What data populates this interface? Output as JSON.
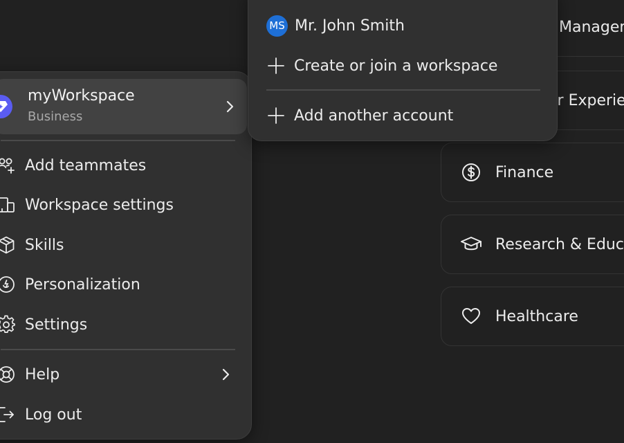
{
  "background_cards": [
    {
      "label": "Managem",
      "icon": "none"
    },
    {
      "label": "er Experie",
      "icon": "none"
    },
    {
      "label": "Finance",
      "icon": "dollar-circle-icon"
    },
    {
      "label": "Research & Educa",
      "icon": "graduation-cap-icon"
    },
    {
      "label": "Healthcare",
      "icon": "heart-icon"
    }
  ],
  "workspace": {
    "name": "myWorkspace",
    "plan": "Business",
    "badge_icon": "diamond-sparkle-icon",
    "badge_color": "#5a5cf2"
  },
  "menu_items": [
    {
      "label": "Add teammates",
      "icon": "add-people-icon"
    },
    {
      "label": "Workspace settings",
      "icon": "building-icon"
    },
    {
      "label": "Skills",
      "icon": "cube-icon"
    },
    {
      "label": "Personalization",
      "icon": "personalization-icon"
    },
    {
      "label": "Settings",
      "icon": "gear-icon"
    },
    {
      "label": "Help",
      "icon": "lifebuoy-icon"
    },
    {
      "label": "Log out",
      "icon": "logout-icon"
    }
  ],
  "account_menu": {
    "user": {
      "initials": "MS",
      "name": "Mr. John Smith",
      "avatar_color": "#1e6fd6"
    },
    "create_join_label": "Create or join a workspace",
    "add_account_label": "Add another account"
  },
  "colors": {
    "background": "#212121",
    "menu_surface": "#303030",
    "highlight": "#424242",
    "text": "#ececec",
    "muted_text": "#a9a9a9"
  }
}
